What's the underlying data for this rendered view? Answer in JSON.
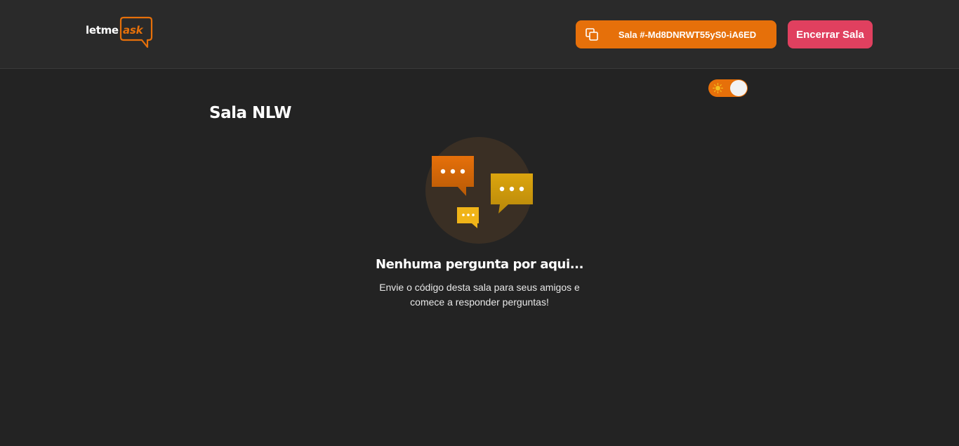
{
  "header": {
    "logo": {
      "prefix": "letme",
      "accent": "ask"
    },
    "room_code": {
      "label": "Sala #-Md8DNRWT55yS0-iA6ED",
      "icon": "copy-icon"
    },
    "close_room_label": "Encerrar Sala"
  },
  "theme_toggle": {
    "icon": "sun-icon",
    "state": "on"
  },
  "room": {
    "title": "Sala NLW"
  },
  "empty_state": {
    "illustration": "chat-bubbles-icon",
    "title": "Nenhuma pergunta por aqui...",
    "description_line1": "Envie o código desta sala para seus amigos e",
    "description_line2": "comece a responder perguntas!"
  },
  "colors": {
    "background": "#232323",
    "header": "#2a2a2a",
    "accent": "#e6700a",
    "danger": "#e0405f"
  }
}
